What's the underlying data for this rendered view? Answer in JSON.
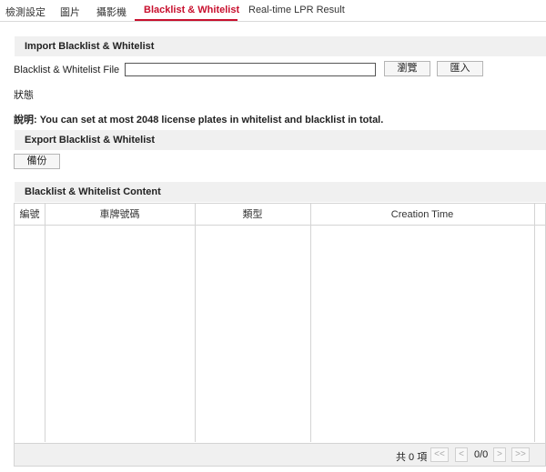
{
  "tabs": [
    {
      "label": "檢測設定"
    },
    {
      "label": "圖片"
    },
    {
      "label": "攝影機"
    },
    {
      "label": "Blacklist & Whitelist",
      "active": true
    },
    {
      "label": "Real-time LPR Result"
    }
  ],
  "accent_color": "#c8102e",
  "import_section": {
    "title": "Import Blacklist & Whitelist",
    "file_label": "Blacklist & Whitelist File",
    "file_value": "",
    "browse_button": "瀏覽",
    "import_button": "匯入",
    "status_label": "狀態"
  },
  "note": "說明: You can set at most 2048 license plates in whitelist and blacklist in total.",
  "export_section": {
    "title": "Export Blacklist & Whitelist",
    "backup_button": "備份"
  },
  "content_section": {
    "title": "Blacklist & Whitelist Content",
    "columns": [
      "編號",
      "車牌號碼",
      "類型",
      "Creation Time"
    ],
    "rows": []
  },
  "pagination": {
    "total_text": "共 0 項",
    "first": "<<",
    "prev": "<",
    "page_text": "0/0",
    "next": ">",
    "last": ">>"
  }
}
